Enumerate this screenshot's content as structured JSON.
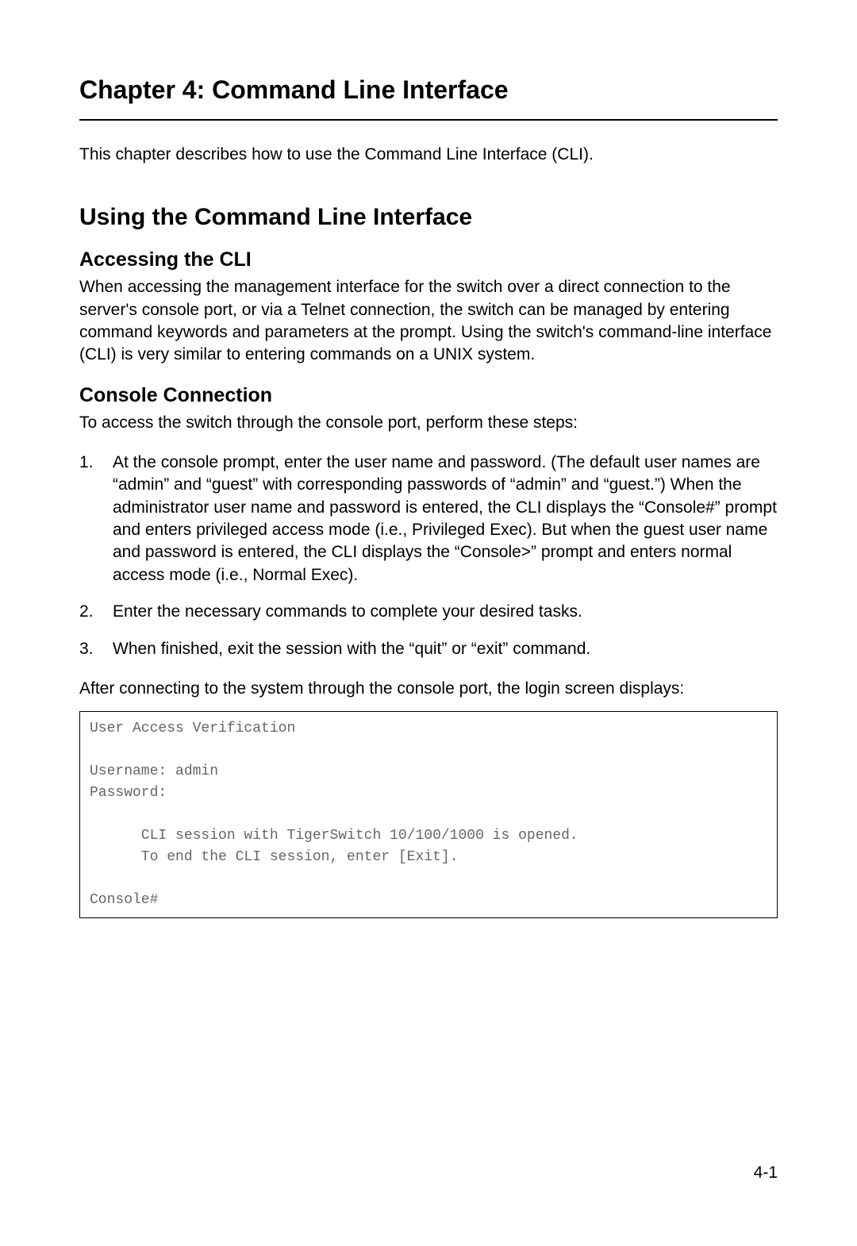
{
  "chapter_title": "Chapter 4: Command Line Interface",
  "intro": "This chapter describes how to use the Command Line Interface (CLI).",
  "section": {
    "title": "Using the Command Line Interface",
    "subsections": [
      {
        "title": "Accessing the CLI",
        "body": "When accessing the management interface for the switch over a direct connection to the server's console port, or via a Telnet connection, the switch can be managed by entering command keywords and parameters at the prompt. Using the switch's command-line interface (CLI) is very similar to entering commands on a UNIX system."
      },
      {
        "title": "Console Connection",
        "body": "To access the switch through the console port, perform these steps:",
        "steps": [
          "At the console prompt, enter the user name and password. (The default user names are “admin” and “guest” with corresponding passwords of “admin” and “guest.”) When the administrator user name and password is entered, the CLI displays the “Console#” prompt and enters privileged access mode (i.e., Privileged Exec). But when the guest user name and password is entered, the CLI displays the “Console>” prompt and enters normal access mode (i.e., Normal Exec).",
          "Enter the necessary commands to complete your desired tasks.",
          "When finished, exit the session with the “quit” or “exit” command."
        ],
        "after": "After connecting to the system through the console port, the login screen displays:",
        "code": "User Access Verification\n\nUsername: admin\nPassword:\n\n      CLI session with TigerSwitch 10/100/1000 is opened.\n      To end the CLI session, enter [Exit].\n\nConsole#"
      }
    ]
  },
  "page_number": "4-1"
}
